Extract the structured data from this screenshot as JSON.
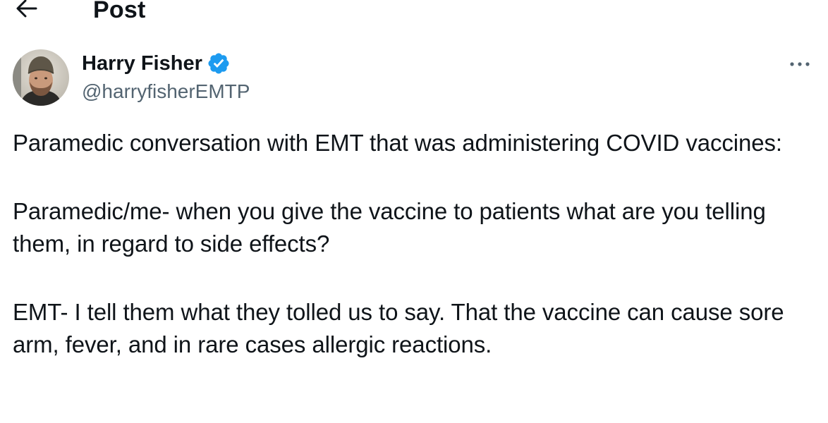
{
  "header": {
    "title": "Post",
    "back_icon": "arrow-left-icon"
  },
  "author": {
    "display_name": "Harry Fisher",
    "handle": "@harryfisherEMTP",
    "verified": true,
    "verified_icon": "verified-badge-icon",
    "verified_color": "#1d9bf0",
    "more_icon": "more-horizontal-icon"
  },
  "post": {
    "paragraphs": [
      "Paramedic conversation with EMT that was administering COVID vaccines:",
      "Paramedic/me- when you give the vaccine to patients what are you telling them, in regard to side effects?",
      "EMT- I tell them what they tolled us to say. That the vaccine can cause sore arm, fever, and in rare cases allergic reactions."
    ]
  },
  "colors": {
    "text": "#0f1419",
    "secondary_text": "#536471",
    "background": "#ffffff"
  }
}
